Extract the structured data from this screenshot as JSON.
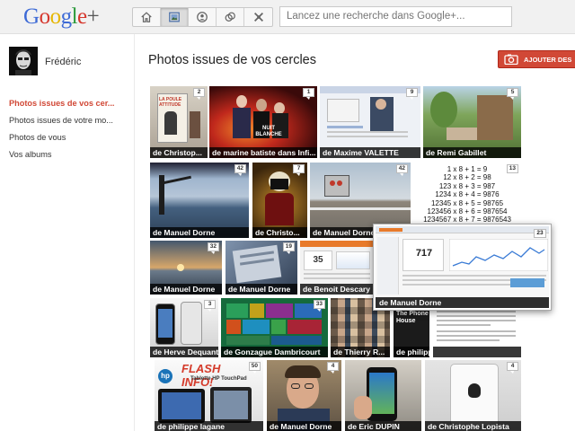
{
  "header": {
    "logo": {
      "letters": [
        "G",
        "o",
        "o",
        "g",
        "l",
        "e",
        "+"
      ],
      "colors": [
        "#3d6ad6",
        "#d6382e",
        "#e6b600",
        "#3d6ad6",
        "#2c9a3c",
        "#d6382e",
        "#555555"
      ]
    },
    "nav_icons": [
      "home-icon",
      "photos-icon",
      "profile-icon",
      "circles-icon",
      "games-icon"
    ],
    "search": {
      "placeholder": "Lancez une recherche dans Google+..."
    }
  },
  "sidebar": {
    "user_name": "Frédéric",
    "items": [
      {
        "label": "Photos issues de vos cer...",
        "active": true
      },
      {
        "label": "Photos issues de votre mo...",
        "active": false
      },
      {
        "label": "Photos de vous",
        "active": false
      },
      {
        "label": "Vos albums",
        "active": false
      }
    ]
  },
  "main": {
    "title": "Photos issues de vos cercles",
    "add_button_label": "AJOUTER DES",
    "accent_color": "#d14836",
    "photos": [
      {
        "caption": "de Christop...",
        "count": "2"
      },
      {
        "caption": "de marine batiste dans Infi...",
        "count": "1"
      },
      {
        "caption": "de Maxime VALETTE",
        "count": "9"
      },
      {
        "caption": "de Remi Gabillet",
        "count": "5"
      },
      {
        "caption": "de Manuel Dorne",
        "count": "42"
      },
      {
        "caption": "de Christo...",
        "count": "7"
      },
      {
        "caption": "de Manuel Dorne",
        "count": "42"
      },
      {
        "caption": "",
        "count": "13"
      },
      {
        "caption": "de Manuel Dorne",
        "count": "32"
      },
      {
        "caption": "de Manuel Dorne",
        "count": "19"
      },
      {
        "caption": "de Benoit Descary",
        "count": ""
      },
      {
        "caption": "de Herve Dequant",
        "count": "3"
      },
      {
        "caption": "de Gonzague Dambricourt",
        "count": "33"
      },
      {
        "caption": "de Thierry R...",
        "count": ""
      },
      {
        "caption": "de philippe lagane",
        "count": ""
      },
      {
        "caption": "de philippe lagane",
        "count": "50"
      },
      {
        "caption": "de Manuel Dorne",
        "count": "4"
      },
      {
        "caption": "de Eric DUPIN",
        "count": ""
      },
      {
        "caption": "de Christophe Lopista",
        "count": "4"
      }
    ],
    "popup": {
      "caption": "de Manuel Dorne",
      "count": "23",
      "stat": "717"
    },
    "math_lines": [
      "1 x 8 + 1 = 9",
      "12 x 8 + 2 = 98",
      "123 x 8 + 3 = 987",
      "1234 x 8 + 4 = 9876",
      "12345 x 8 + 5 = 98765",
      "123456 x 8 + 6 = 987654",
      "1234567 x 8 + 7 = 9876543"
    ],
    "photo_texts": {
      "book": "LA POULE ATTITUDE",
      "nuit": "NUIT BLANCHE",
      "flash": "FLASH INFO!",
      "tablette": "Tablette HP TouchPad",
      "hp": "hp",
      "phone_house": "The Phone House",
      "stat_box": "35"
    }
  }
}
